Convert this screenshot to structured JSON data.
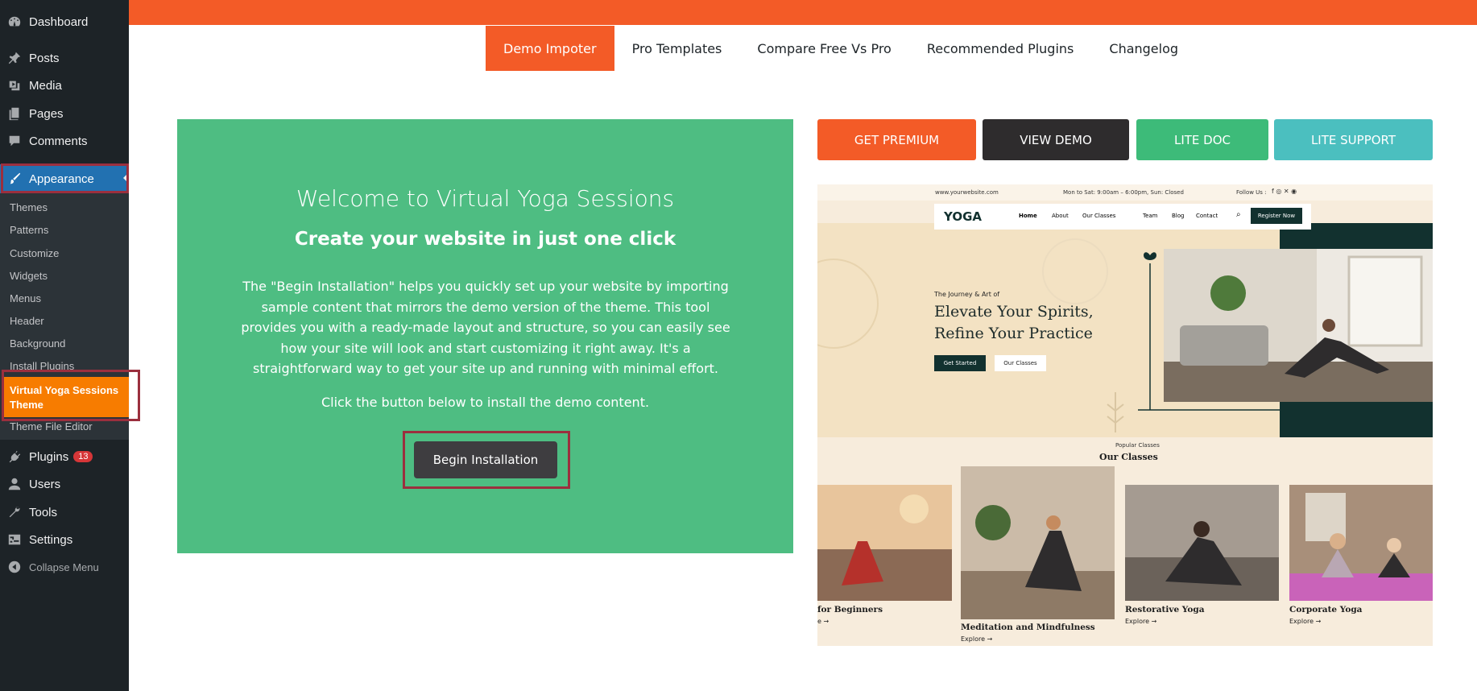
{
  "sidebar": {
    "dashboard": "Dashboard",
    "posts": "Posts",
    "media": "Media",
    "pages": "Pages",
    "comments": "Comments",
    "appearance": "Appearance",
    "submenu": [
      "Themes",
      "Patterns",
      "Customize",
      "Widgets",
      "Menus",
      "Header",
      "Background",
      "Install Plugins"
    ],
    "current_line1": "Virtual Yoga Sessions",
    "current_line2": "Theme",
    "theme_file_editor": "Theme File Editor",
    "plugins": "Plugins",
    "plugins_count": "13",
    "users": "Users",
    "tools": "Tools",
    "settings": "Settings",
    "collapse": "Collapse Menu"
  },
  "tabs": [
    "Demo Impoter",
    "Pro Templates",
    "Compare Free Vs Pro",
    "Recommended Plugins",
    "Changelog"
  ],
  "welcome": {
    "title": "Welcome to Virtual Yoga Sessions",
    "subtitle": "Create your website in just one click",
    "description": "The \"Begin Installation\" helps you quickly set up your website by importing sample content that mirrors the demo version of the theme. This tool provides you with a ready-made layout and structure, so you can easily see how your site will look and start customizing it right away. It's a straightforward way to get your site up and running with minimal effort.",
    "hint": "Click the button below to install the demo content.",
    "button": "Begin Installation"
  },
  "actions": {
    "get_premium": "GET PREMIUM",
    "view_demo": "VIEW DEMO",
    "lite_doc": "LITE DOC",
    "lite_support": "LITE SUPPORT"
  },
  "colors": {
    "accent_orange": "#f35b27",
    "green": "#4ebd82",
    "dark": "#2e2c2d",
    "lite_doc": "#3dbb79",
    "lite_support": "#4bbfbf",
    "wp_blue": "#2271b1"
  },
  "preview": {
    "website": "www.yourwebsite.com",
    "hours": "Mon to Sat: 9:00am – 6:00pm, Sun: Closed",
    "follow": "Follow Us :",
    "logo": "YOGA",
    "nav": [
      "Home",
      "About",
      "Our Classes",
      "Team",
      "Blog",
      "Contact"
    ],
    "register": "Register Now",
    "kicker": "The Journey & Art of",
    "headline1": "Elevate Your Spirits,",
    "headline2": "Refine Your Practice",
    "btn_started": "Get Started",
    "btn_classes": "Our Classes",
    "popular": "Popular Classes",
    "our_classes": "Our Classes",
    "cards": [
      {
        "title": "for Beginners",
        "explore": "e →"
      },
      {
        "title": "Meditation and Mindfulness",
        "explore": "Explore →"
      },
      {
        "title": "Restorative Yoga",
        "explore": "Explore →"
      },
      {
        "title": "Corporate Yoga",
        "explore": "Explore →"
      }
    ]
  }
}
